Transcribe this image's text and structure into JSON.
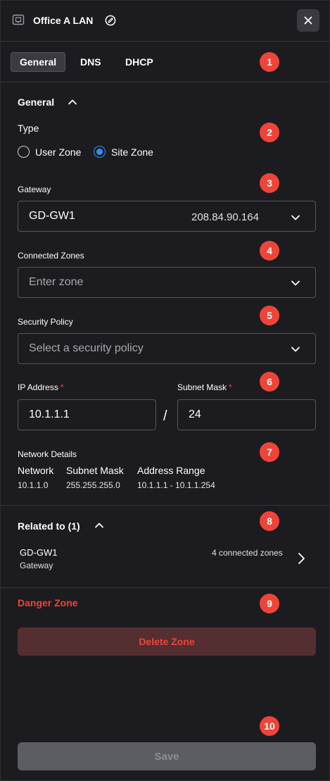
{
  "header": {
    "title": "Office A LAN",
    "icon": "network-port-icon",
    "edit_icon": "edit-icon",
    "close_icon": "close-icon"
  },
  "tabs": [
    {
      "label": "General",
      "active": true
    },
    {
      "label": "DNS",
      "active": false
    },
    {
      "label": "DHCP",
      "active": false
    }
  ],
  "badges": [
    "1",
    "2",
    "3",
    "4",
    "5",
    "6",
    "7",
    "8",
    "9",
    "10"
  ],
  "general": {
    "section_title": "General",
    "type": {
      "label": "Type",
      "options": [
        {
          "label": "User Zone",
          "selected": false
        },
        {
          "label": "Site Zone",
          "selected": true
        }
      ]
    },
    "gateway": {
      "label": "Gateway",
      "name": "GD-GW1",
      "ip": "208.84.90.164"
    },
    "connected_zones": {
      "label": "Connected Zones",
      "placeholder": "Enter zone"
    },
    "security_policy": {
      "label": "Security Policy",
      "placeholder": "Select a security policy"
    },
    "ip_address": {
      "label": "IP Address",
      "required_mark": "*",
      "value": "10.1.1.1"
    },
    "separator": "/",
    "subnet_mask": {
      "label": "Subnet Mask",
      "required_mark": "*",
      "value": "24"
    },
    "network_details": {
      "label": "Network Details",
      "columns": [
        {
          "header": "Network",
          "value": "10.1.1.0"
        },
        {
          "header": "Subnet Mask",
          "value": "255.255.255.0"
        },
        {
          "header": "Address Range",
          "value": "10.1.1.1 - 10.1.1.254"
        }
      ]
    }
  },
  "related": {
    "title": "Related to (1)",
    "items": [
      {
        "name": "GD-GW1",
        "type": "Gateway",
        "detail": "4 connected zones"
      }
    ]
  },
  "danger": {
    "title": "Danger Zone",
    "button_label": "Delete Zone"
  },
  "footer": {
    "save_label": "Save"
  },
  "colors": {
    "background": "#1c1c20",
    "accent": "#2e90fa",
    "danger": "#f04438",
    "badge": "#f04438"
  }
}
